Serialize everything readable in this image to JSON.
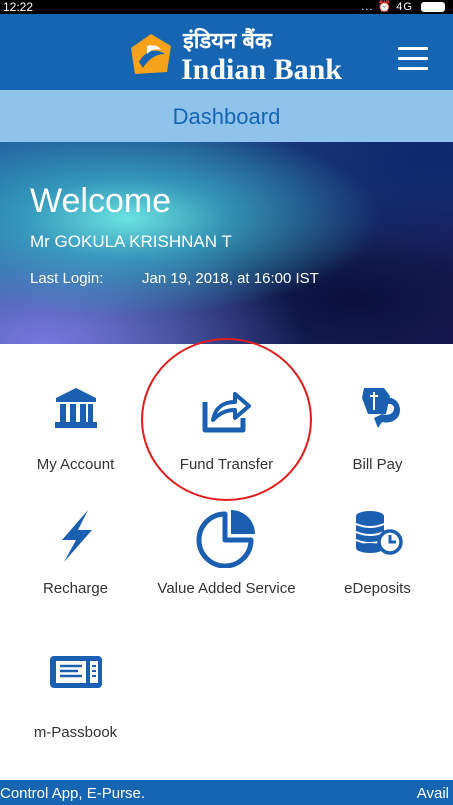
{
  "status_bar": {
    "time": "12:22",
    "indicators": "... ⏰ 4G"
  },
  "header": {
    "brand_hindi": "इंडियन बैंक",
    "brand_english": "Indian Bank",
    "menu_icon": "hamburger-menu-icon",
    "colors": {
      "primary": "#1565b2",
      "accent": "#f7a21b"
    }
  },
  "dashboard": {
    "title": "Dashboard",
    "bar_color": "#8fc3ec"
  },
  "welcome": {
    "greeting": "Welcome",
    "user_name": "Mr GOKULA KRISHNAN T",
    "last_login_label": "Last Login:",
    "last_login_value": "Jan 19, 2018, at 16:00 IST"
  },
  "tiles": [
    {
      "label": "My Account",
      "icon": "bank-building-icon"
    },
    {
      "label": "Fund Transfer",
      "icon": "share-arrow-icon"
    },
    {
      "label": "Bill Pay",
      "icon": "bill-pay-icon"
    },
    {
      "label": "Recharge",
      "icon": "lightning-bolt-icon"
    },
    {
      "label": "Value Added Service",
      "icon": "pie-chart-icon"
    },
    {
      "label": "eDeposits",
      "icon": "coins-clock-icon"
    },
    {
      "label": "m-Passbook",
      "icon": "passbook-icon"
    }
  ],
  "ticker": {
    "left_text": "Control App, E-Purse.",
    "right_text": "Avail"
  },
  "highlight_color": "#e31b1b"
}
